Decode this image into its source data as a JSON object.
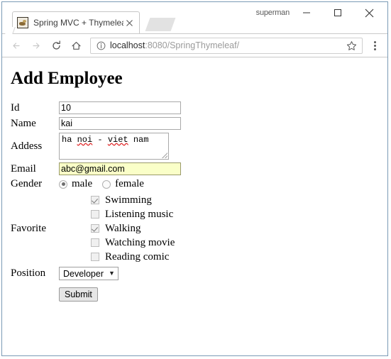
{
  "browser": {
    "profile_name": "superman",
    "tab": {
      "title": "Spring MVC + Thymeleaf",
      "favicon": "spring-favicon",
      "close_label": "×"
    },
    "omnibox": {
      "host": "localhost",
      "path": ":8080/SpringThymeleaf/",
      "info_icon": "info-circle-icon",
      "star_icon": "bookmark-star-icon"
    },
    "nav": {
      "back": "back-arrow-icon",
      "forward": "forward-arrow-icon",
      "reload": "reload-icon",
      "home": "home-icon",
      "menu": "three-dot-menu-icon"
    },
    "window_controls": {
      "minimize": "minimize-icon",
      "maximize": "maximize-icon",
      "close": "close-icon"
    }
  },
  "page": {
    "title": "Add Employee",
    "fields": {
      "id": {
        "label": "Id",
        "value": "10"
      },
      "name": {
        "label": "Name",
        "value": "kai"
      },
      "address": {
        "label": "Addess",
        "value_parts": [
          {
            "text": "ha ",
            "misspelled": false
          },
          {
            "text": "noi",
            "misspelled": true
          },
          {
            "text": " - ",
            "misspelled": false
          },
          {
            "text": "viet",
            "misspelled": true
          },
          {
            "text": " nam",
            "misspelled": false
          }
        ]
      },
      "email": {
        "label": "Email",
        "value": "abc@gmail.com",
        "autofill": true
      },
      "gender": {
        "label": "Gender",
        "options": [
          {
            "label": "male",
            "checked": true
          },
          {
            "label": "female",
            "checked": false
          }
        ]
      },
      "favorite": {
        "label": "Favorite",
        "options": [
          {
            "label": "Swimming",
            "checked": true
          },
          {
            "label": "Listening music",
            "checked": false
          },
          {
            "label": "Walking",
            "checked": true
          },
          {
            "label": "Watching movie",
            "checked": false
          },
          {
            "label": "Reading comic",
            "checked": false
          }
        ]
      },
      "position": {
        "label": "Position",
        "selected": "Developer",
        "arrow": "▼"
      }
    },
    "submit_label": "Submit"
  },
  "colors": {
    "window_border": "#7a9ab5",
    "autofill_background": "#faffc8",
    "spellcheck_underline": "#e02020"
  }
}
